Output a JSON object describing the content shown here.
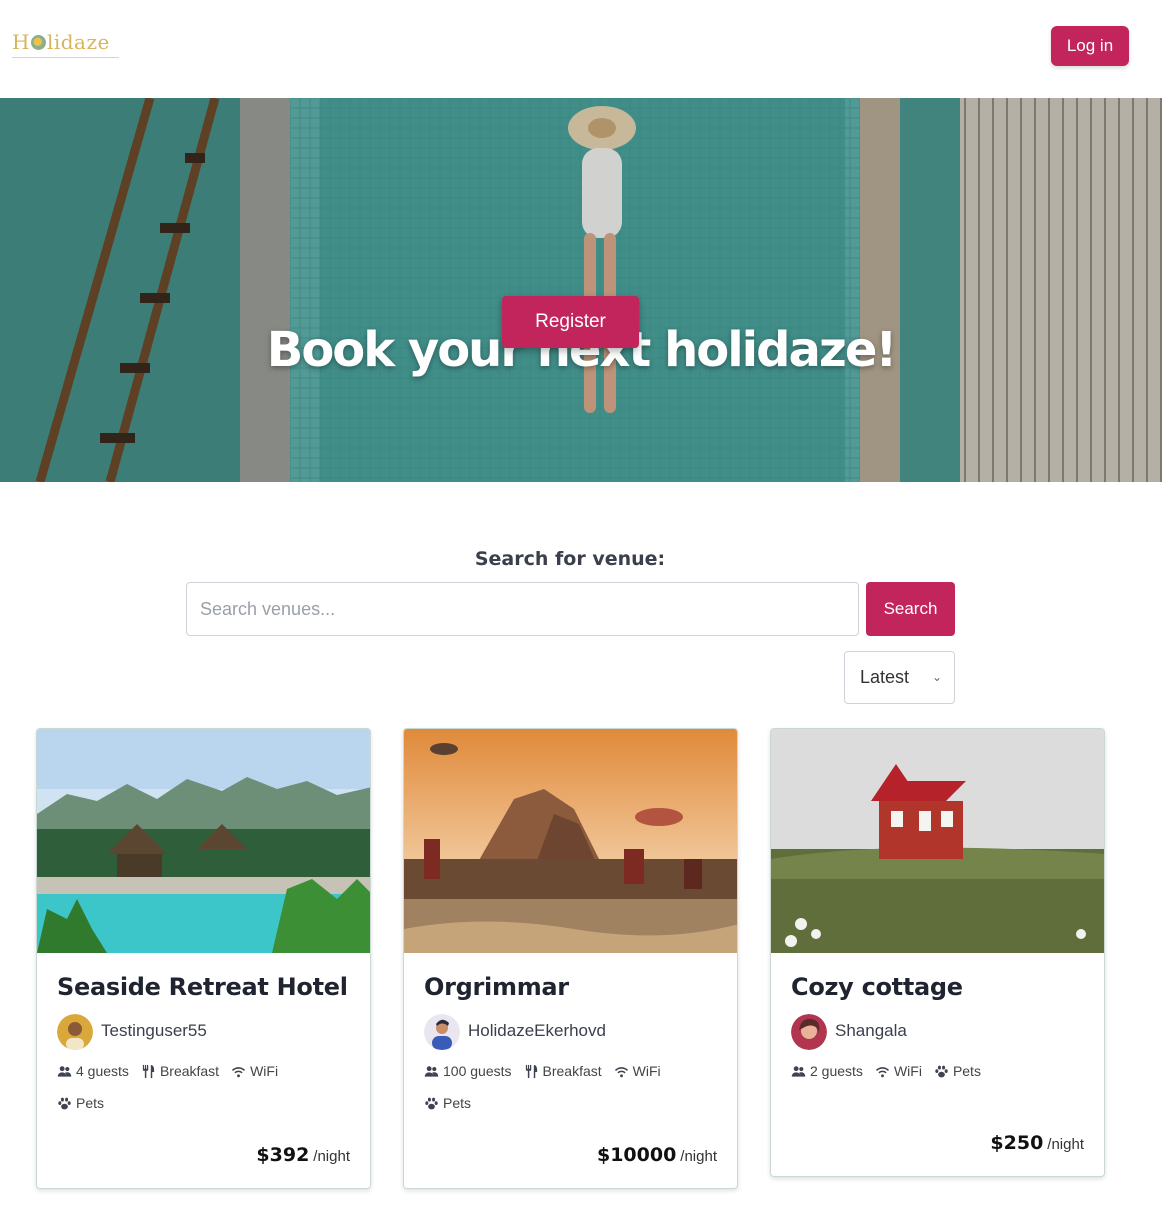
{
  "header": {
    "logo_text_start": "H",
    "logo_text_end": "lidaze",
    "login_label": "Log in"
  },
  "hero": {
    "title": "Book your next holidaze!",
    "register_label": "Register"
  },
  "search": {
    "label": "Search for venue:",
    "placeholder": "Search venues...",
    "button_label": "Search",
    "sort_value": "Latest"
  },
  "colors": {
    "accent": "#c2255c",
    "logo": "#d8b45e"
  },
  "venues": [
    {
      "name": "Seaside Retreat Hotel",
      "owner": "Testinguser55",
      "amenities": [
        "4 guests",
        "Breakfast",
        "WiFi",
        "Pets"
      ],
      "price": "$392",
      "per": "/night"
    },
    {
      "name": "Orgrimmar",
      "owner": "HolidazeEkerhovd",
      "amenities": [
        "100 guests",
        "Breakfast",
        "WiFi",
        "Pets"
      ],
      "price": "$10000",
      "per": "/night"
    },
    {
      "name": "Cozy cottage",
      "owner": "Shangala",
      "amenities": [
        "2 guests",
        "WiFi",
        "Pets"
      ],
      "price": "$250",
      "per": "/night"
    }
  ]
}
